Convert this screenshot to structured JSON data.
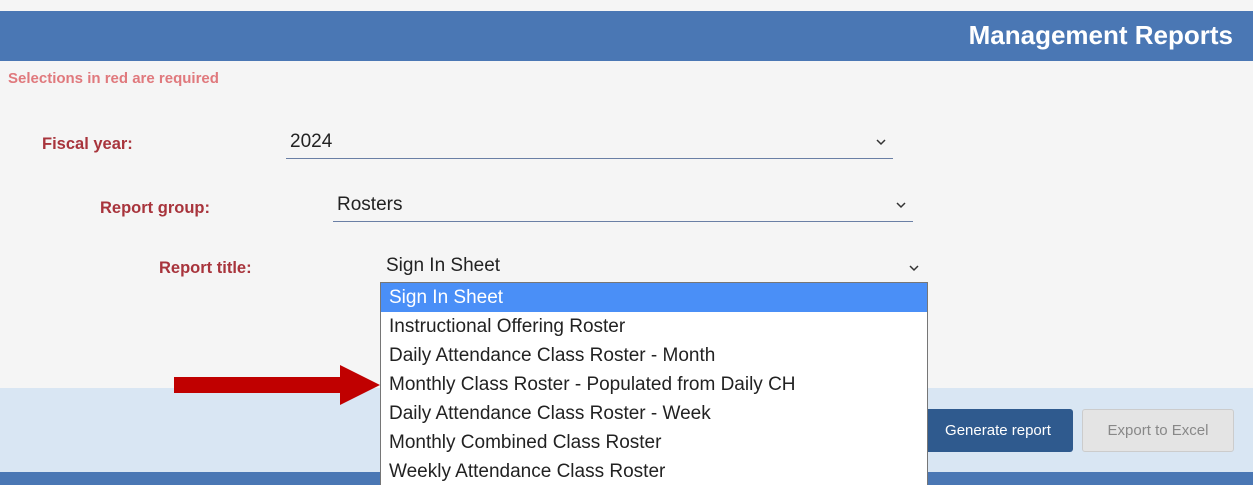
{
  "header": {
    "title": "Management Reports"
  },
  "required_note": "Selections in red are required",
  "form": {
    "fiscal_year": {
      "label": "Fiscal year:",
      "value": "2024"
    },
    "report_group": {
      "label": "Report group:",
      "value": "Rosters"
    },
    "report_title": {
      "label": "Report title:",
      "value": "Sign In Sheet",
      "options": [
        "Sign In Sheet",
        "Instructional Offering Roster",
        "Daily Attendance Class Roster - Month",
        "Monthly Class Roster - Populated from Daily CH",
        "Daily Attendance Class Roster - Week",
        "Monthly Combined Class Roster",
        "Weekly Attendance Class Roster"
      ],
      "highlighted_index": 0,
      "arrow_points_to_index": 3
    }
  },
  "buttons": {
    "generate": "Generate report",
    "export": "Export to Excel"
  },
  "colors": {
    "header": "#4a77b4",
    "required_label": "#a8343c",
    "note": "#e0797d",
    "arrow": "#c00000",
    "selected_option": "#4a8ff7",
    "generate_button": "#2f5a8e"
  }
}
